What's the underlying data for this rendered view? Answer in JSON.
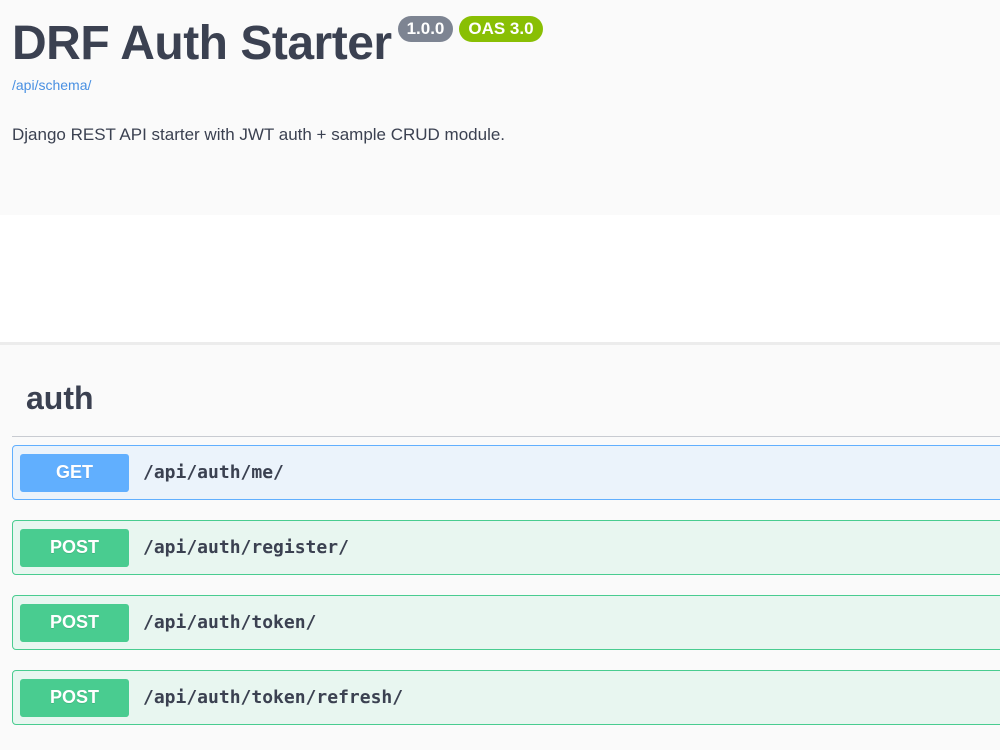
{
  "info": {
    "title": "DRF Auth Starter",
    "version_badge": "1.0.0",
    "oas_badge": "OAS 3.0",
    "schema_link": "/api/schema/",
    "description": "Django REST API starter with JWT auth + sample CRUD module."
  },
  "tag": {
    "name": "auth",
    "operations": [
      {
        "method": "GET",
        "path": "/api/auth/me/"
      },
      {
        "method": "POST",
        "path": "/api/auth/register/"
      },
      {
        "method": "POST",
        "path": "/api/auth/token/"
      },
      {
        "method": "POST",
        "path": "/api/auth/token/refresh/"
      }
    ]
  },
  "colors": {
    "get": "#61affe",
    "post": "#49cc90",
    "oas_badge": "#89bf04",
    "version_badge": "#7d8492",
    "link": "#4990e2"
  }
}
